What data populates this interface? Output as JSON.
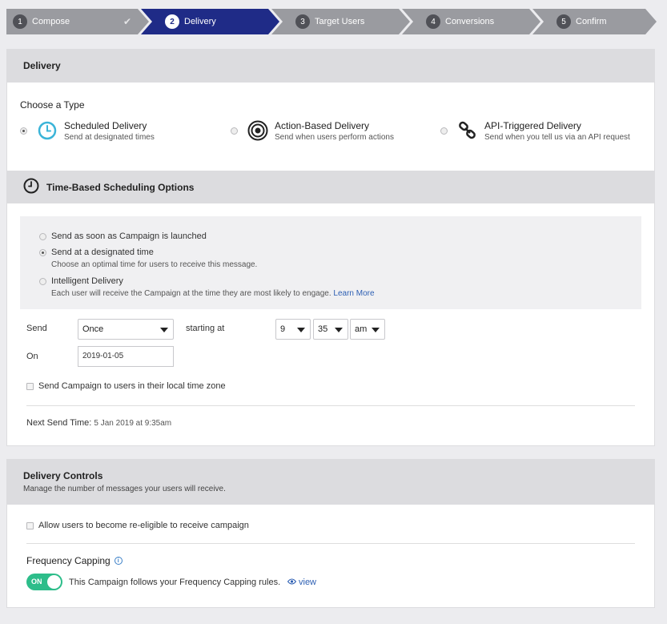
{
  "wizard": {
    "steps": [
      {
        "num": "1",
        "label": "Compose",
        "done": true
      },
      {
        "num": "2",
        "label": "Delivery",
        "active": true
      },
      {
        "num": "3",
        "label": "Target Users"
      },
      {
        "num": "4",
        "label": "Conversions"
      },
      {
        "num": "5",
        "label": "Confirm"
      }
    ],
    "check_glyph": "✔"
  },
  "delivery": {
    "title": "Delivery",
    "choose_type": "Choose a Type",
    "types": [
      {
        "title": "Scheduled Delivery",
        "subtitle": "Send at designated times",
        "icon": "clock-icon",
        "selected": true
      },
      {
        "title": "Action-Based Delivery",
        "subtitle": "Send when users perform actions",
        "icon": "target-icon",
        "selected": false
      },
      {
        "title": "API-Triggered Delivery",
        "subtitle": "Send when you tell us via an API request",
        "icon": "link-icon",
        "selected": false
      }
    ],
    "accent_color": "#3bb4d8"
  },
  "scheduling": {
    "title": "Time-Based Scheduling Options",
    "options": [
      {
        "label": "Send as soon as Campaign is launched",
        "selected": false
      },
      {
        "label": "Send at a designated time",
        "sub": "Choose an optimal time for users to receive this message.",
        "selected": true
      },
      {
        "label": "Intelligent Delivery",
        "sub": "Each user will receive the Campaign at the time they are most likely to engage.",
        "link": "Learn More",
        "selected": false
      }
    ],
    "send_label": "Send",
    "send_value": "Once",
    "starting_at_label": "starting at",
    "hour": "9",
    "minute": "35",
    "ampm": "am",
    "on_label": "On",
    "date_value": "2019-01-05",
    "local_tz_label": "Send Campaign to users in their local time zone",
    "next_send_label": "Next Send Time:",
    "next_send_value": "5 Jan 2019 at 9:35am"
  },
  "controls": {
    "title": "Delivery Controls",
    "subtitle": "Manage the number of messages your users will receive.",
    "reeligible_label": "Allow users to become re-eligible to receive campaign",
    "freq_title": "Frequency Capping",
    "info_glyph": "i",
    "toggle_label": "ON",
    "toggle_on": true,
    "freq_text": "This Campaign follows your Frequency Capping rules.",
    "view_label": "view",
    "toggle_color": "#2dbd8a"
  }
}
